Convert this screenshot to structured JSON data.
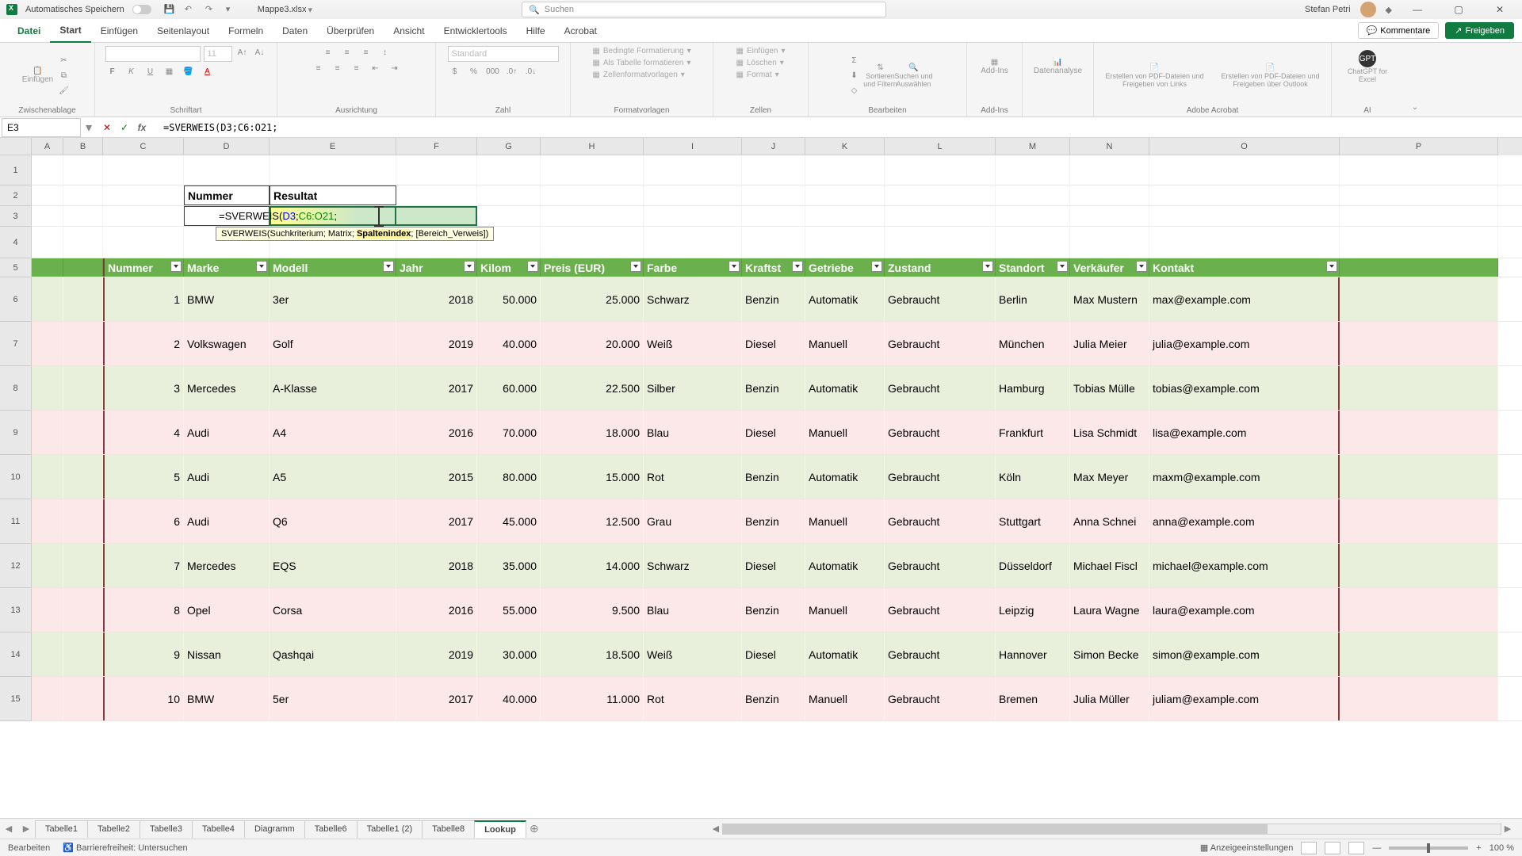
{
  "titlebar": {
    "autosave_label": "Automatisches Speichern",
    "filename": "Mappe3.xlsx",
    "search_placeholder": "Suchen",
    "username": "Stefan Petri"
  },
  "ribbon_tabs": [
    "Datei",
    "Start",
    "Einfügen",
    "Seitenlayout",
    "Formeln",
    "Daten",
    "Überprüfen",
    "Ansicht",
    "Entwicklertools",
    "Hilfe",
    "Acrobat"
  ],
  "ribbon_active_tab": "Start",
  "ribbon_right": {
    "comments": "Kommentare",
    "share": "Freigeben"
  },
  "ribbon_groups": {
    "clipboard": {
      "paste": "Einfügen",
      "label": "Zwischenablage"
    },
    "font": {
      "label": "Schriftart",
      "size": "11"
    },
    "alignment": {
      "label": "Ausrichtung"
    },
    "number": {
      "format": "Standard",
      "label": "Zahl"
    },
    "styles": {
      "cond": "Bedingte Formatierung",
      "table": "Als Tabelle formatieren",
      "cellstyles": "Zellenformatvorlagen",
      "label": "Formatvorlagen"
    },
    "cells": {
      "insert": "Einfügen",
      "delete": "Löschen",
      "format": "Format",
      "label": "Zellen"
    },
    "editing": {
      "sort": "Sortieren und Filtern",
      "find": "Suchen und Auswählen",
      "label": "Bearbeiten"
    },
    "addins": {
      "addins": "Add-Ins",
      "label": "Add-Ins"
    },
    "analysis": {
      "btn": "Datenanalyse"
    },
    "acrobat": {
      "pdf1": "Erstellen von PDF-Dateien und Freigeben von Links",
      "pdf2": "Erstellen von PDF-Dateien und Freigeben über Outlook",
      "label": "Adobe Acrobat"
    },
    "ai": {
      "btn": "ChatGPT for Excel",
      "label": "AI"
    }
  },
  "namebox": "E3",
  "formula": "=SVERWEIS(D3;C6:O21;",
  "tooltip": {
    "full": "SVERWEIS(Suchkriterium; Matrix; Spaltenindex; [Bereich_Verweis])",
    "before": "SVERWEIS(Suchkriterium; Matrix; ",
    "active": "Spaltenindex",
    "after": "; [Bereich_Verweis])"
  },
  "columns": [
    "A",
    "B",
    "C",
    "D",
    "E",
    "F",
    "G",
    "H",
    "I",
    "J",
    "K",
    "L",
    "M",
    "N",
    "O",
    "P"
  ],
  "lookup": {
    "h1": "Nummer",
    "h2": "Resultat"
  },
  "table": {
    "headers": [
      "Nummer",
      "Marke",
      "Modell",
      "Jahr",
      "Kilom",
      "Preis (EUR)",
      "Farbe",
      "Kraftst",
      "Getriebe",
      "Zustand",
      "Standort",
      "Verkäufer",
      "Kontakt"
    ],
    "rows": [
      {
        "n": "1",
        "marke": "BMW",
        "modell": "3er",
        "jahr": "2018",
        "km": "50.000",
        "preis": "25.000",
        "farbe": "Schwarz",
        "kraft": "Benzin",
        "getr": "Automatik",
        "zust": "Gebraucht",
        "ort": "Berlin",
        "verk": "Max Mustern",
        "mail": "max@example.com"
      },
      {
        "n": "2",
        "marke": "Volkswagen",
        "modell": "Golf",
        "jahr": "2019",
        "km": "40.000",
        "preis": "20.000",
        "farbe": "Weiß",
        "kraft": "Diesel",
        "getr": "Manuell",
        "zust": "Gebraucht",
        "ort": "München",
        "verk": "Julia Meier",
        "mail": "julia@example.com"
      },
      {
        "n": "3",
        "marke": "Mercedes",
        "modell": "A-Klasse",
        "jahr": "2017",
        "km": "60.000",
        "preis": "22.500",
        "farbe": "Silber",
        "kraft": "Benzin",
        "getr": "Automatik",
        "zust": "Gebraucht",
        "ort": "Hamburg",
        "verk": "Tobias Mülle",
        "mail": "tobias@example.com"
      },
      {
        "n": "4",
        "marke": "Audi",
        "modell": "A4",
        "jahr": "2016",
        "km": "70.000",
        "preis": "18.000",
        "farbe": "Blau",
        "kraft": "Diesel",
        "getr": "Manuell",
        "zust": "Gebraucht",
        "ort": "Frankfurt",
        "verk": "Lisa Schmidt",
        "mail": "lisa@example.com"
      },
      {
        "n": "5",
        "marke": "Audi",
        "modell": "A5",
        "jahr": "2015",
        "km": "80.000",
        "preis": "15.000",
        "farbe": "Rot",
        "kraft": "Benzin",
        "getr": "Automatik",
        "zust": "Gebraucht",
        "ort": "Köln",
        "verk": "Max Meyer",
        "mail": "maxm@example.com"
      },
      {
        "n": "6",
        "marke": "Audi",
        "modell": "Q6",
        "jahr": "2017",
        "km": "45.000",
        "preis": "12.500",
        "farbe": "Grau",
        "kraft": "Benzin",
        "getr": "Manuell",
        "zust": "Gebraucht",
        "ort": "Stuttgart",
        "verk": "Anna Schnei",
        "mail": "anna@example.com"
      },
      {
        "n": "7",
        "marke": "Mercedes",
        "modell": "EQS",
        "jahr": "2018",
        "km": "35.000",
        "preis": "14.000",
        "farbe": "Schwarz",
        "kraft": "Diesel",
        "getr": "Automatik",
        "zust": "Gebraucht",
        "ort": "Düsseldorf",
        "verk": "Michael Fiscl",
        "mail": "michael@example.com"
      },
      {
        "n": "8",
        "marke": "Opel",
        "modell": "Corsa",
        "jahr": "2016",
        "km": "55.000",
        "preis": "9.500",
        "farbe": "Blau",
        "kraft": "Benzin",
        "getr": "Manuell",
        "zust": "Gebraucht",
        "ort": "Leipzig",
        "verk": "Laura Wagne",
        "mail": "laura@example.com"
      },
      {
        "n": "9",
        "marke": "Nissan",
        "modell": "Qashqai",
        "jahr": "2019",
        "km": "30.000",
        "preis": "18.500",
        "farbe": "Weiß",
        "kraft": "Diesel",
        "getr": "Automatik",
        "zust": "Gebraucht",
        "ort": "Hannover",
        "verk": "Simon Becke",
        "mail": "simon@example.com"
      },
      {
        "n": "10",
        "marke": "BMW",
        "modell": "5er",
        "jahr": "2017",
        "km": "40.000",
        "preis": "11.000",
        "farbe": "Rot",
        "kraft": "Benzin",
        "getr": "Manuell",
        "zust": "Gebraucht",
        "ort": "Bremen",
        "verk": "Julia Müller",
        "mail": "juliam@example.com"
      }
    ]
  },
  "sheets": [
    "Tabelle1",
    "Tabelle2",
    "Tabelle3",
    "Tabelle4",
    "Diagramm",
    "Tabelle6",
    "Tabelle1 (2)",
    "Tabelle8",
    "Lookup"
  ],
  "sheet_active": "Lookup",
  "statusbar": {
    "mode": "Bearbeiten",
    "access": "Barrierefreiheit: Untersuchen",
    "display": "Anzeigeeinstellungen",
    "zoom": "100 %"
  }
}
